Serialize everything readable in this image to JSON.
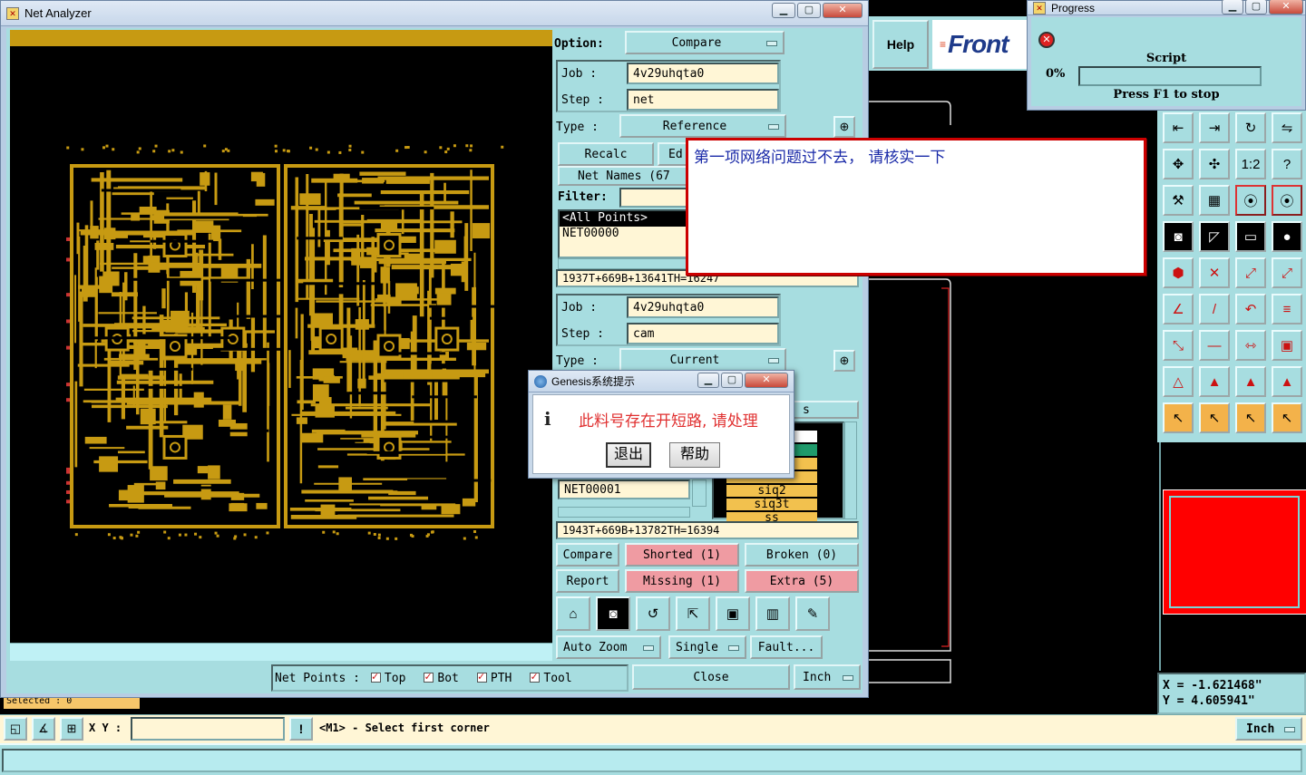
{
  "net_analyzer": {
    "title": "Net Analyzer",
    "option_label": "Option:",
    "option_value": "Compare",
    "job_label": "Job  :",
    "job1_value": "4v29uhqta0",
    "step_label": "Step :",
    "step1_value": "net",
    "type_label": "Type  :",
    "type1_value": "Reference",
    "recalc": "Recalc",
    "edit_partial": "Ed",
    "net_names": "Net Names (67",
    "filter_label": "Filter:",
    "list1": [
      "<All Points>",
      "NET00000"
    ],
    "summary1": "1937T+669B+13641TH=16247",
    "job2_value": "4v29uhqta0",
    "step2_value": "cam",
    "type2_value": "Current",
    "list2_bottom": "NET00001",
    "layers": [
      "",
      "",
      "",
      "",
      "siq2",
      "siq3t",
      "ss"
    ],
    "summary2": "1943T+669B+13782TH=16394",
    "compare": "Compare",
    "shorted": "Shorted (1)",
    "broken": "Broken (0)",
    "report": "Report",
    "missing": "Missing (1)",
    "extra": "Extra (5)",
    "auto_zoom": "Auto Zoom",
    "single": "Single",
    "fault": "Fault...",
    "net_points": "Net Points :",
    "top": "Top",
    "bot": "Bot",
    "pth": "PTH",
    "tool": "Tool",
    "close": "Close",
    "unit": "Inch",
    "partial_s": "s"
  },
  "main": {
    "help": "Help",
    "logo": "Front",
    "selected": "Selected : 0",
    "xy_label": "X Y :",
    "xy_value": "",
    "prompt": "<M1> - Select first corner",
    "unit": "Inch",
    "coord_x": "X = -1.621468\"",
    "coord_y": "Y = 4.605941\""
  },
  "progress": {
    "title": "Progress",
    "script": "Script",
    "percent": "0%",
    "hint": "Press F1 to stop",
    "value": 0
  },
  "note": {
    "text": "第一项网络问题过不去， 请核实一下"
  },
  "dialog": {
    "title": "Genesis系统提示",
    "message": "此料号存在开短路, 请处理",
    "exit": "退出",
    "help": "帮助"
  },
  "colors": {
    "pcb": "#c79a12",
    "panel": "#a7dde0",
    "pink": "#ef9ba2",
    "alert_red": "#cc0000"
  }
}
